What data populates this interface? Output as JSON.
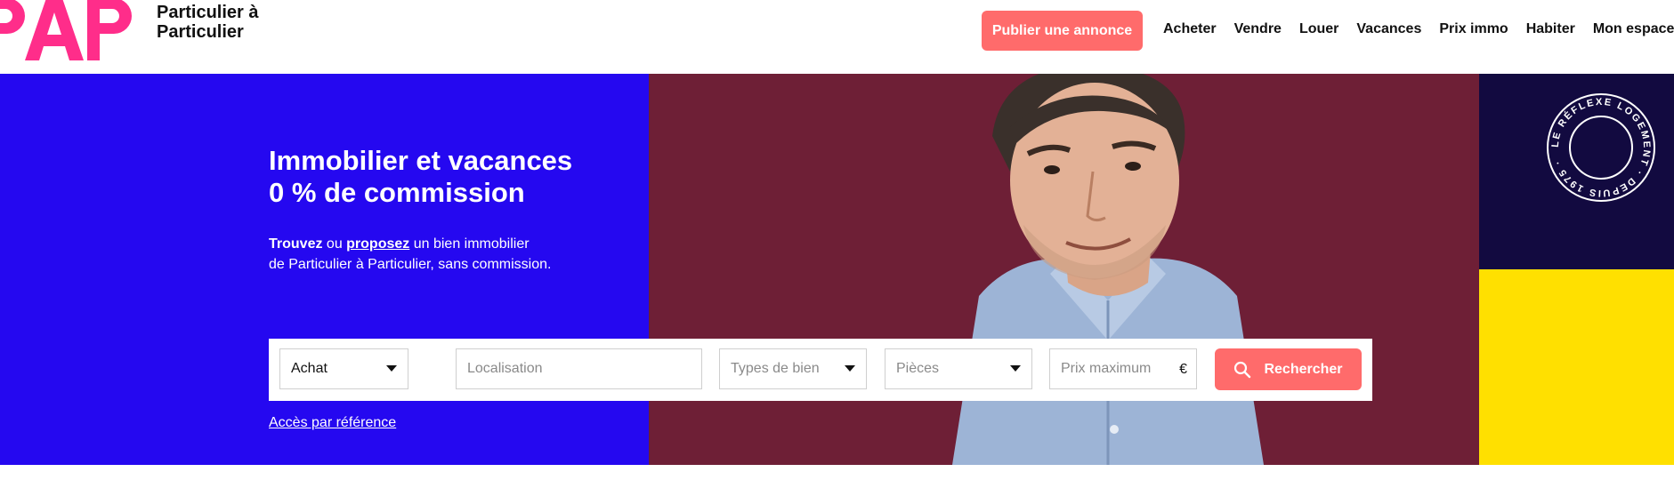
{
  "brand": {
    "logo_text": "PAP",
    "tagline_line1": "Particulier à",
    "tagline_line2": "Particulier",
    "color": "#ff2d8a"
  },
  "header": {
    "publish_label": "Publier une annonce",
    "nav": [
      "Acheter",
      "Vendre",
      "Louer",
      "Vacances",
      "Prix immo",
      "Habiter",
      "Mon espace"
    ]
  },
  "hero": {
    "title_line1": "Immobilier et vacances",
    "title_line2": "0 % de commission",
    "sub_find": "Trouvez",
    "sub_or": " ou ",
    "sub_propose": "proposez",
    "sub_rest": " un bien immobilier",
    "sub_line2": "de Particulier à Particulier, sans commission.",
    "seal_text": "LE RÉFLEXE LOGEMENT · DEPUIS 1975 ·",
    "colors": {
      "blue": "#2508f0",
      "maroon": "#6e1f36",
      "navy": "#120a40",
      "yellow": "#ffe000"
    }
  },
  "search": {
    "transaction_value": "Achat",
    "location_placeholder": "Localisation",
    "type_placeholder": "Types de bien",
    "rooms_placeholder": "Pièces",
    "price_placeholder": "Prix maximum",
    "currency": "€",
    "submit_label": "Rechercher",
    "accent": "#ff6b6b"
  },
  "links": {
    "reference": "Accès par référence"
  }
}
